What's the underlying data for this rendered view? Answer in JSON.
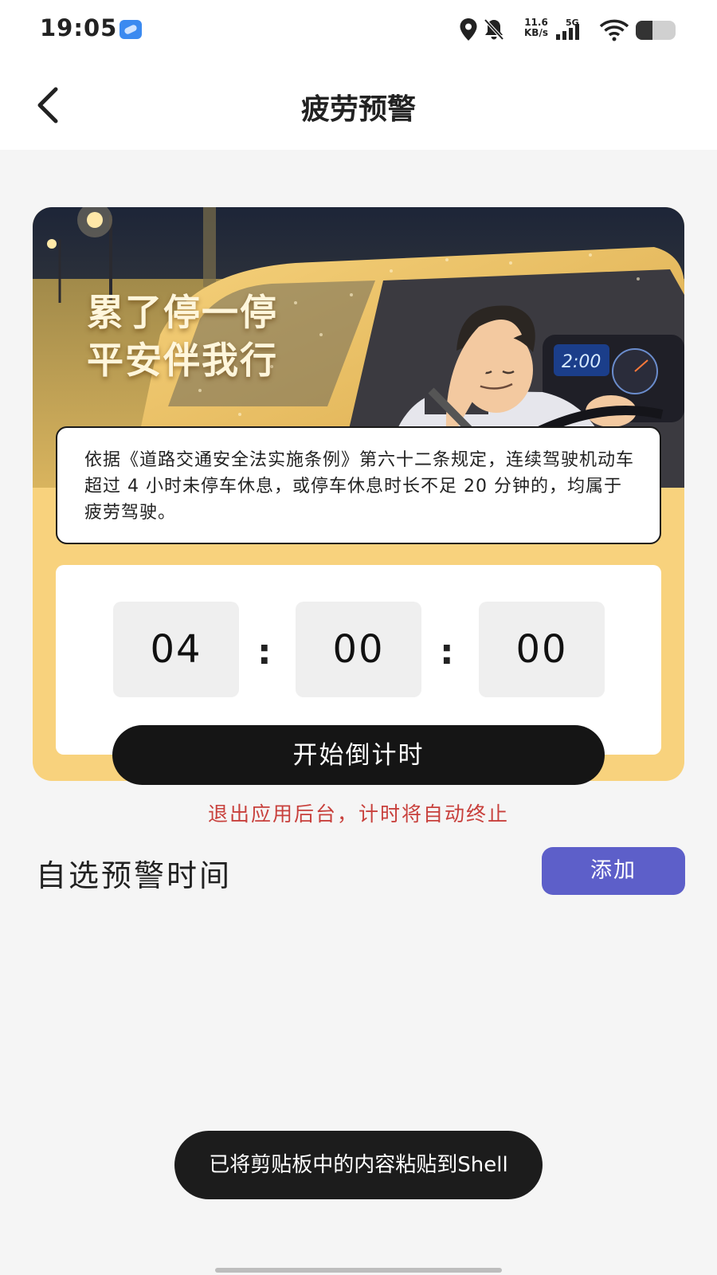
{
  "status_bar": {
    "time": "19:05",
    "net_speed_value": "11.6",
    "net_speed_unit": "KB/s",
    "network": "5G",
    "battery_level": 0.42,
    "icons": [
      "location-icon",
      "bell-muted-icon",
      "signal-icon",
      "wifi-icon",
      "battery-icon"
    ]
  },
  "header": {
    "title": "疲劳预警",
    "back_icon": "chevron-left-icon"
  },
  "hero": {
    "slogan_line1": "累了停一停",
    "slogan_line2": "平安伴我行",
    "dashboard_clock": "2:00",
    "law_text": "依据《道路交通安全法实施条例》第六十二条规定，连续驾驶机动车超过 4 小时未停车休息，或停车休息时长不足 20 分钟的，均属于疲劳驾驶。"
  },
  "timer": {
    "hours": "04",
    "minutes": "00",
    "seconds": "00",
    "separator": ":",
    "start_label": "开始倒计时"
  },
  "warning": "退出应用后台，计时将自动终止",
  "custom_section": {
    "title": "自选预警时间",
    "add_label": "添加"
  },
  "toast": "已将剪贴板中的内容粘贴到Shell",
  "colors": {
    "card_yellow": "#f8d27d",
    "button_dark": "#151515",
    "warning_red": "#c8403c",
    "add_button_purple": "#5d5fc9",
    "background": "#f5f5f5"
  }
}
